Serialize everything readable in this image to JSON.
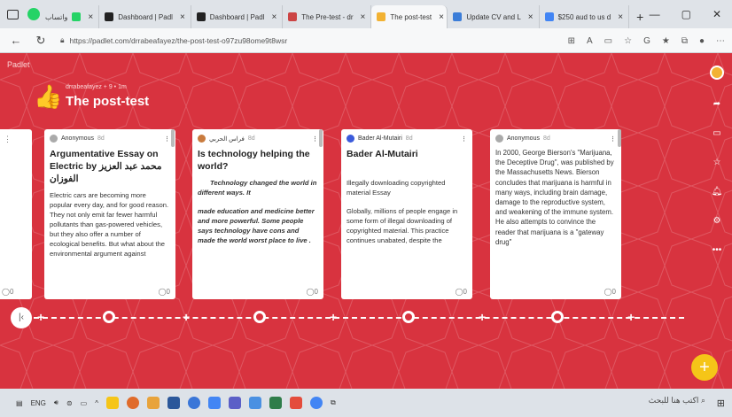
{
  "browser": {
    "tabs": [
      {
        "label": "واتساب",
        "fav": "#25d366"
      },
      {
        "label": "Dashboard | Padl",
        "fav": "#222"
      },
      {
        "label": "Dashboard | Padl",
        "fav": "#222"
      },
      {
        "label": "The Pre-test - dr",
        "fav": "#c44"
      },
      {
        "label": "The post-test",
        "fav": "#f2b233"
      },
      {
        "label": "Update CV and L",
        "fav": "#3b7dd8"
      },
      {
        "label": "$250 aud to us d",
        "fav": "#4285f4"
      }
    ],
    "new_tab": "+",
    "window_controls": [
      "—",
      "▢",
      "✕"
    ],
    "url": "https://padlet.com/drrabeafayez/the-post-test-o97zu98ome9t8wsr"
  },
  "padlet": {
    "brand": "Padlet",
    "meta": "drrabeafayez + 9 • 1m",
    "title": "The post-test",
    "rail_icons": [
      "share-icon",
      "remake-icon",
      "star-icon",
      "bell-icon",
      "gear-icon",
      "more-icon"
    ],
    "cards": [
      {
        "author": "Anonymous",
        "time": "8d",
        "title": "Argumentative Essay on Electric by محمد عبد العزيز الفوزان",
        "body": "Electric cars are becoming more popular every day, and for good reason. They not only emit far fewer harmful pollutants than gas-powered vehicles, but they also offer a number of ecological benefits. But what about the environmental argument against",
        "comments": "0"
      },
      {
        "author": "فراس الحربي",
        "time": "8d",
        "title": "Is technology helping the world?",
        "body1": "Technology changed the world in different ways. It",
        "body2": "made education and medicine better and more powerful. Some people says technology have cons and made the world worst place to live .",
        "comments": "0"
      },
      {
        "author": "Bader Al-Mutairi",
        "time": "8d",
        "title": "Bader Al-Mutairi",
        "body1": "Illegally downloading copyrighted material Essay",
        "body2": "Globally, millions of people engage in some form of illegal downloading of copyrighted material. This practice continues unabated, despite the",
        "comments": "0"
      },
      {
        "author": "Anonymous",
        "time": "8d",
        "title": "",
        "body": "In 2000, George Bierson's \"Marijuana, the Deceptive Drug\", was published by the Massachusetts News. Bierson concludes that marijuana is harmful in many ways, including brain damage, damage to the reproductive system, and weakening of the immune system. He also attempts to convince the reader that marijuana is a \"gateway drug\"",
        "comments": "0"
      }
    ],
    "partial_card_comments": "0",
    "fab": "+"
  },
  "taskbar": {
    "lang": "ENG",
    "search_placeholder": "اكتب هنا للبحث"
  },
  "colors": {
    "background": "#d8333f",
    "accent": "#f5c518"
  }
}
